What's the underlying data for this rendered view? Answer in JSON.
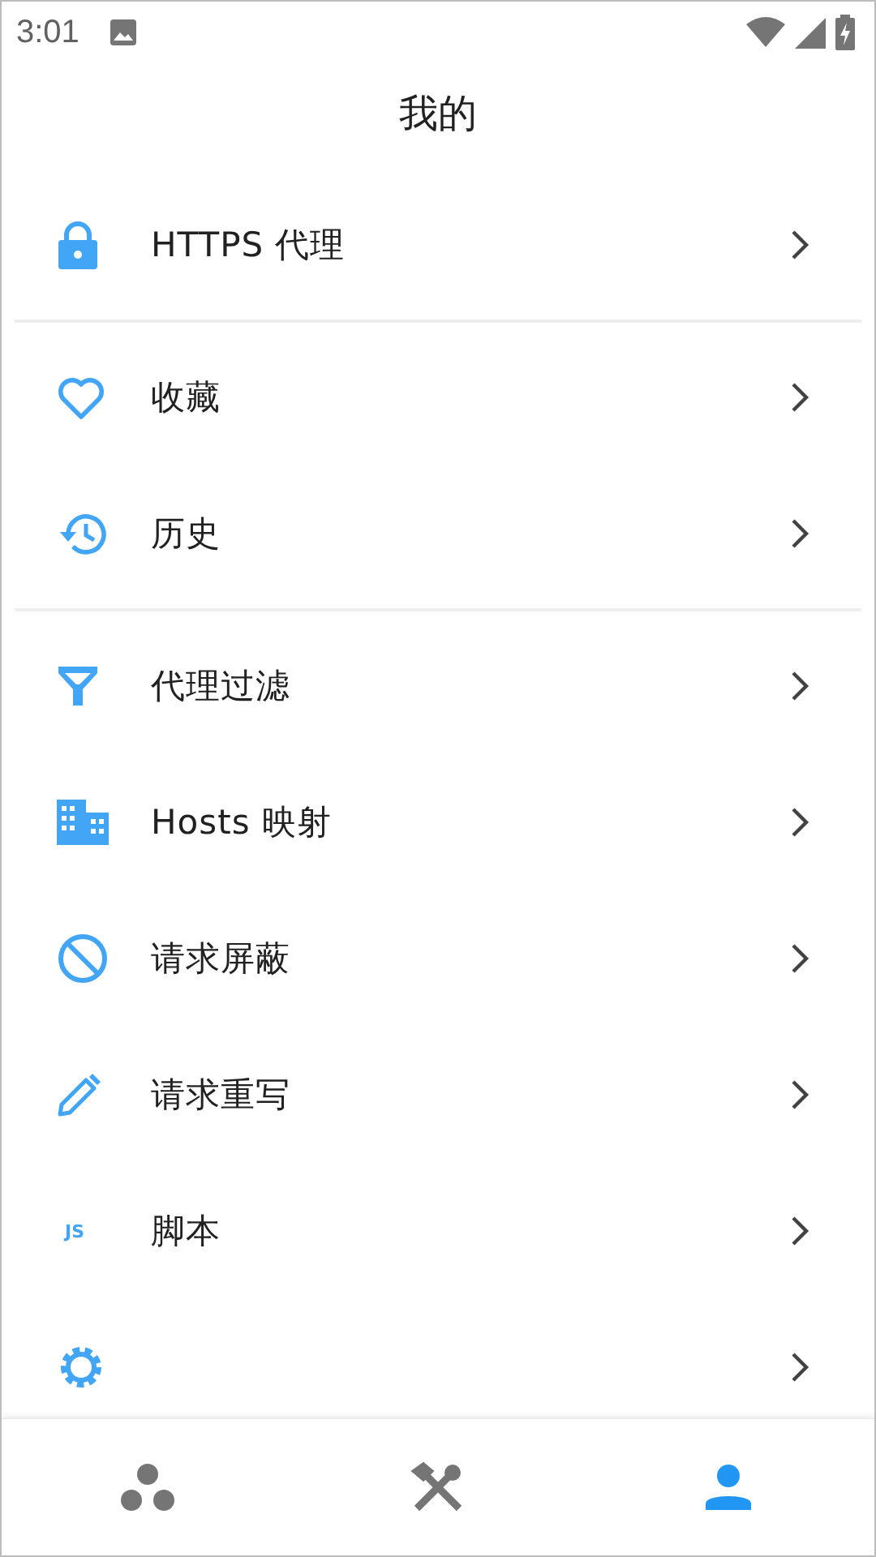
{
  "status_bar": {
    "time": "3:01"
  },
  "title": "我的",
  "sections": [
    {
      "items": [
        {
          "kind": "lock",
          "label": "HTTPS 代理"
        }
      ]
    },
    {
      "items": [
        {
          "kind": "heart",
          "label": "收藏"
        },
        {
          "kind": "history",
          "label": "历史"
        }
      ]
    },
    {
      "items": [
        {
          "kind": "filter",
          "label": "代理过滤"
        },
        {
          "kind": "building",
          "label": "Hosts 映射"
        },
        {
          "kind": "block",
          "label": "请求屏蔽"
        },
        {
          "kind": "pencil",
          "label": "请求重写"
        },
        {
          "kind": "js",
          "icon_text": "JS",
          "label": "脚本"
        },
        {
          "kind": "gear"
        }
      ]
    }
  ],
  "bottom_nav": [
    {
      "kind": "dots",
      "selected": false
    },
    {
      "kind": "tools",
      "selected": false
    },
    {
      "kind": "person",
      "selected": true
    }
  ]
}
